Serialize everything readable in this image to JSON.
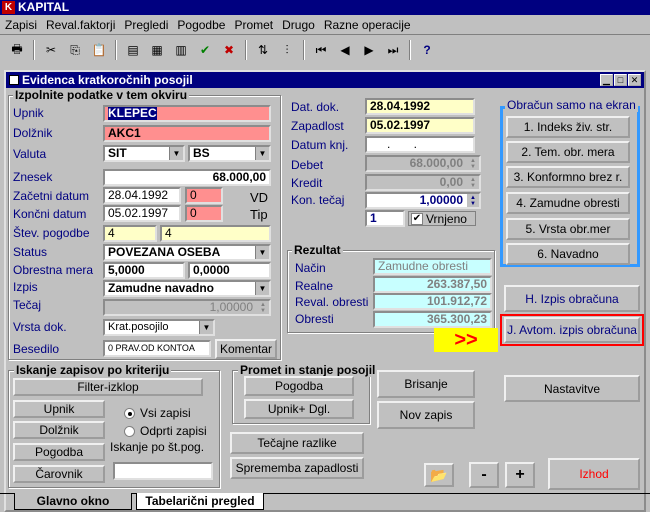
{
  "app": {
    "title": "KAPITAL"
  },
  "menu": [
    "Zapisi",
    "Reval.faktorji",
    "Pregledi",
    "Pogodbe",
    "Promet",
    "Drugo",
    "Razne operacije"
  ],
  "window": {
    "title": "Evidenca kratkoročnih posojil"
  },
  "form": {
    "group_title": "Izpolnite podatke v tem okviru",
    "upnik_label": "Upnik",
    "upnik": "KLEPEC",
    "dolznik_label": "Dolžnik",
    "dolznik": "AKC1",
    "valuta_label": "Valuta",
    "valuta1": "SIT",
    "valuta2": "BS",
    "znesek_label": "Znesek",
    "znesek": "68.000,00",
    "zacetni_label": "Začetni datum",
    "zacetni": "28.04.1992",
    "zacetni_n": "0",
    "vd": "VD",
    "koncni_label": "Končni datum",
    "koncni": "05.02.1997",
    "koncni_n": "0",
    "tip": "Tip",
    "stev_label": "Štev. pogodbe",
    "stev1": "4",
    "stev2": "4",
    "status_label": "Status",
    "status": "POVEZANA OSEBA",
    "obrestna_label": "Obrestna mera",
    "obrestna1": "5,0000",
    "obrestna2": "0,0000",
    "izpis_label": "Izpis",
    "izpis": "Zamudne navadno",
    "tecaj_label": "Tečaj",
    "tecaj": "1,00000",
    "vrsta_label": "Vrsta dok.",
    "vrsta": "Krat.posojilo",
    "besedilo_label": "Besedilo",
    "besedilo": "0 PRAV.OD KONTOA",
    "komentar": "Komentar"
  },
  "dates": {
    "dat_dok_label": "Dat. dok.",
    "dat_dok": "28.04.1992",
    "zapadlost_label": "Zapadlost",
    "zapadlost": "05.02.1997",
    "datum_knj_label": "Datum knj.",
    "datum_knj": ". .",
    "debet_label": "Debet",
    "debet": "68.000,00",
    "kredit_label": "Kredit",
    "kredit": "0,00",
    "kon_tecaj_label": "Kon. tečaj",
    "kon_tecaj": "1,00000",
    "vrnjeno_n": "1",
    "vrnjeno_label": "Vrnjeno",
    "vrnjeno_check": "✔"
  },
  "rezultat": {
    "title": "Rezultat",
    "nacin_label": "Način",
    "nacin": "Zamudne obresti",
    "realne_label": "Realne",
    "realne": "263.387,50",
    "reval_label": "Reval. obresti",
    "reval": "101.912,72",
    "obresti_label": "Obresti",
    "obresti": "365.300,23"
  },
  "obracun": {
    "title": "Obračun samo na ekran",
    "buttons": [
      "1. Indeks živ. str.",
      "2. Tem. obr. mera",
      "3. Konformno brez r.",
      "4. Zamudne obresti",
      "5. Vrsta obr.mer",
      "6. Navadno"
    ]
  },
  "izpis": {
    "h": "H. Izpis obračuna",
    "j": "J. Avtom. izpis obračuna",
    "arrow": ">>"
  },
  "iskanje": {
    "title": "Iskanje zapisov po kriteriju",
    "filter": "Filter-izklop",
    "upnik": "Upnik",
    "dolznik": "Dolžnik",
    "pogodba": "Pogodba",
    "carovnik": "Čarovnik",
    "vsi": "Vsi zapisi",
    "odprti": "Odprti zapisi",
    "po_st": "Iskanje po št.pog."
  },
  "promet": {
    "title": "Promet in stanje posojil",
    "pogodba": "Pogodba",
    "upnik_dgl": "Upnik+ Dgl."
  },
  "actions": {
    "brisanje": "Brisanje",
    "nov": "Nov zapis",
    "nastavitve": "Nastavitve",
    "tecajne": "Tečajne razlike",
    "sprememba": "Sprememba zapadlosti",
    "minus": "-",
    "plus": "+",
    "izhod": "Izhod"
  },
  "tabs": [
    "Glavno okno",
    "Tabelarični pregled"
  ],
  "colors": {
    "pink": "#ff8f8f",
    "yellow": "#ffffc8",
    "cyan": "#c8ffff",
    "navy": "#000080",
    "highlight": "#ffff00",
    "red": "#ff0000"
  }
}
